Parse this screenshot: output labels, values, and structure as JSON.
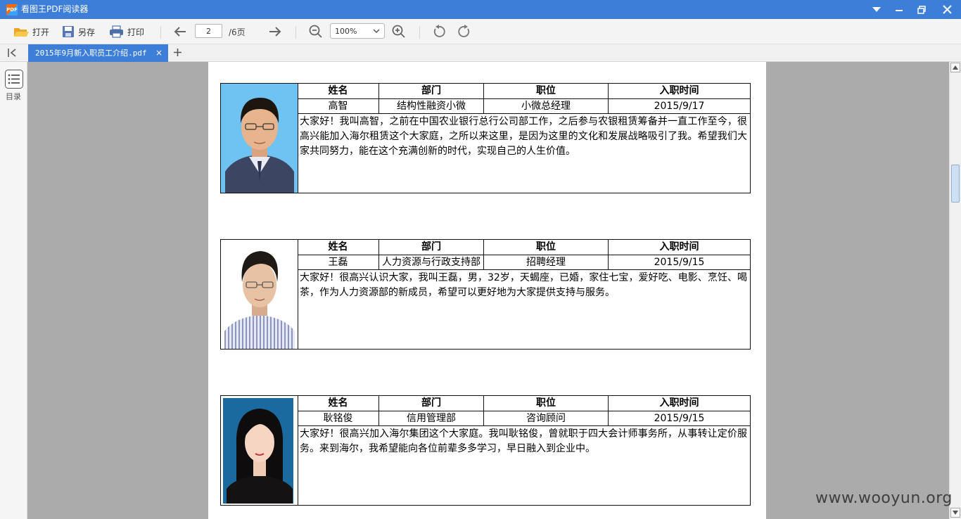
{
  "titlebar": {
    "logo_text": "PDF",
    "title": "看图王PDF阅读器"
  },
  "toolbar": {
    "open_label": "打开",
    "saveas_label": "另存",
    "print_label": "打印",
    "page_value": "2",
    "page_total": "/6页",
    "zoom_value": "100%"
  },
  "tabs": [
    {
      "label": "2015年9月新入职员工介绍.pdf",
      "close": "×"
    }
  ],
  "sidebar": {
    "toc_label": "目录"
  },
  "table_headers": {
    "name": "姓名",
    "dept": "部门",
    "position": "职位",
    "date": "入职时间"
  },
  "employees": [
    {
      "name": "高智",
      "dept": "结构性融资小微",
      "position": "小微总经理",
      "date": "2015/9/17",
      "intro": "大家好！我叫高智，之前在中国农业银行总行公司部工作，之后参与农银租赁筹备并一直工作至今，很高兴能加入海尔租赁这个大家庭，之所以来这里，是因为这里的文化和发展战略吸引了我。希望我们大家共同努力，能在这个充满创新的时代，实现自己的人生价值。"
    },
    {
      "name": "王磊",
      "dept": "人力资源与行政支持部",
      "position": "招聘经理",
      "date": "2015/9/15",
      "intro": "大家好！很高兴认识大家，我叫王磊，男，32岁，天蝎座，已婚，家住七宝，爱好吃、电影、烹饪、喝茶，作为人力资源部的新成员，希望可以更好地为大家提供支持与服务。"
    },
    {
      "name": "耿铭俊",
      "dept": "信用管理部",
      "position": "咨询顾问",
      "date": "2015/9/15",
      "intro": "大家好！很高兴加入海尔集团这个大家庭。我叫耿铭俊，曾就职于四大会计师事务所，从事转让定价服务。来到海尔，我希望能向各位前辈多多学习，早日融入到企业中。"
    }
  ],
  "watermark": "www.wooyun.org",
  "colors": {
    "accent": "#3d7ed8",
    "viewer_bg": "#ababab"
  }
}
